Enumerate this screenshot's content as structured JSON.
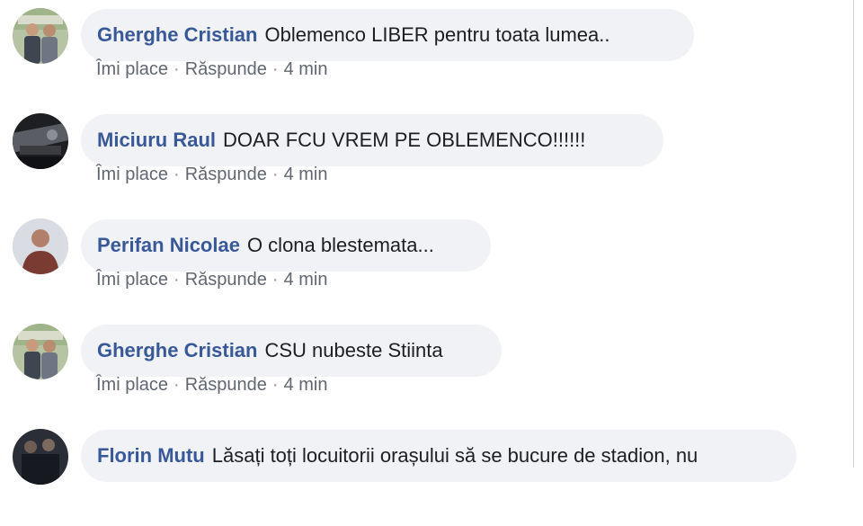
{
  "comments": [
    {
      "author": "Gherghe Cristian",
      "text": "Oblemenco LIBER pentru toata lumea..",
      "like_label": "Îmi place",
      "reply_label": "Răspunde",
      "time": "4 min",
      "separator": "·",
      "avatar": "photo-two-people-outdoors"
    },
    {
      "author": "Miciuru Raul",
      "text": "DOAR FCU VREM PE OBLEMENCO!!!!!!",
      "like_label": "Îmi place",
      "reply_label": "Răspunde",
      "time": "4 min",
      "separator": "·",
      "avatar": "photo-dark-car-interior"
    },
    {
      "author": "Perifan Nicolae",
      "text": "O clona blestemata...",
      "like_label": "Îmi place",
      "reply_label": "Răspunde",
      "time": "4 min",
      "separator": "·",
      "avatar": "photo-man-portrait"
    },
    {
      "author": "Gherghe Cristian",
      "text": "CSU nubeste Stiinta",
      "like_label": "Îmi place",
      "reply_label": "Răspunde",
      "time": "4 min",
      "separator": "·",
      "avatar": "photo-two-people-outdoors"
    },
    {
      "author": "Florin Mutu",
      "text": "Lăsați toți locuitorii orașului să se bucure de stadion, nu",
      "avatar": "photo-group-dark"
    }
  ],
  "colors": {
    "author": "#385898",
    "text": "#1c1e21",
    "meta": "#616770",
    "bubble": "#f0f2f5"
  }
}
